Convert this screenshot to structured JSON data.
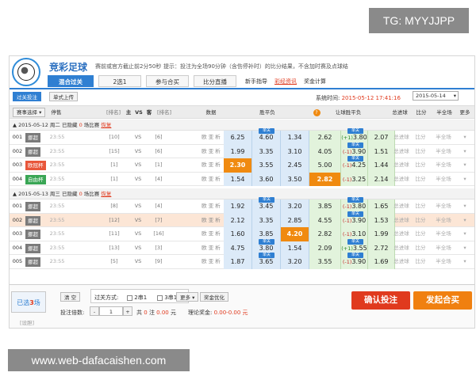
{
  "overlay": {
    "tg": "TG: MYYJJPP",
    "watermark": "www.web-dafacaishen.com"
  },
  "header": {
    "title": "竞彩足球",
    "tip_deadline": "赛前或官方截止前2分50秒",
    "tip_note": "提示：投注为全场90分钟（含伤停补时）的比分结果，不含加时赛及点球结",
    "tabs": [
      "混合过关",
      "2选1",
      "参与合买",
      "比分直播"
    ],
    "links": [
      "新手指导",
      "彩经资讯",
      "奖金计算"
    ]
  },
  "toolbar": {
    "btn_parlay": "过关投注",
    "btn_single": "单式上传",
    "systime_label": "系统时间:",
    "systime_value": "2015-05-12 17:41:16",
    "date_value": "2015-05-14"
  },
  "columns": {
    "filter": "赛事选择",
    "stop": "停售",
    "rank_home": "[排名]",
    "home": "主",
    "vs": "VS",
    "away": "客",
    "rank_away": "[排名]",
    "data": "数据",
    "spf": "胜平负",
    "rq": "让球胜平负",
    "goals": "总进球",
    "score": "比分",
    "half": "半全场",
    "more": "更多"
  },
  "groups": [
    {
      "date": "2015-05-12 周二",
      "hidden_label": "已隐藏",
      "hidden_count": "0",
      "hidden_suffix": "场比赛",
      "show_link": "恢复",
      "rows": [
        {
          "no": "001",
          "league": "挪超",
          "lcolor": "#7a7a7a",
          "time": "23:55",
          "rh": "[10]",
          "vs": "VS",
          "ra": "[6]",
          "data": "欧 亚 析",
          "spf": [
            "6.25",
            "4.60",
            "1.34"
          ],
          "spf_pick": -1,
          "dan": true,
          "rq_line": "(+1)",
          "rq_neg": false,
          "rq": [
            "2.62",
            "3.80",
            "2.07"
          ],
          "rq_pick": -1,
          "rq_dan": true,
          "goals": "总进球",
          "score": "比分",
          "half": "半全场",
          "hl": false
        },
        {
          "no": "002",
          "league": "挪超",
          "lcolor": "#7a7a7a",
          "time": "23:55",
          "rh": "[15]",
          "vs": "VS",
          "ra": "[6]",
          "data": "欧 亚 析",
          "spf": [
            "1.99",
            "3.35",
            "3.10"
          ],
          "spf_pick": -1,
          "dan": false,
          "rq_line": "(-1)",
          "rq_neg": true,
          "rq": [
            "4.05",
            "3.90",
            "1.51"
          ],
          "rq_pick": -1,
          "rq_dan": true,
          "goals": "总进球",
          "score": "比分",
          "half": "半全场",
          "hl": false
        },
        {
          "no": "003",
          "league": "欧冠杯",
          "lcolor": "#e8563a",
          "time": "23:55",
          "rh": "[1]",
          "vs": "VS",
          "ra": "[1]",
          "data": "欧 亚 析",
          "spf": [
            "2.30",
            "3.55",
            "2.45"
          ],
          "spf_pick": 0,
          "dan": false,
          "rq_line": "(-1)",
          "rq_neg": true,
          "rq": [
            "5.00",
            "4.25",
            "1.44"
          ],
          "rq_pick": -1,
          "rq_dan": true,
          "goals": "总进球",
          "score": "比分",
          "half": "半全场",
          "hl": false
        },
        {
          "no": "004",
          "league": "自由杯",
          "lcolor": "#3aa655",
          "time": "23:55",
          "rh": "[1]",
          "vs": "VS",
          "ra": "[4]",
          "data": "欧 亚 析",
          "spf": [
            "1.54",
            "3.60",
            "3.50"
          ],
          "spf_pick": -1,
          "dan": false,
          "rq_line": "(-1)",
          "rq_neg": true,
          "rq": [
            "2.82",
            "3.25",
            "2.14"
          ],
          "rq_pick": 0,
          "rq_dan": false,
          "goals": "总进球",
          "score": "比分",
          "half": "半全场",
          "hl": false
        }
      ]
    },
    {
      "date": "2015-05-13 周三",
      "hidden_label": "已隐藏",
      "hidden_count": "0",
      "hidden_suffix": "场比赛",
      "show_link": "恢复",
      "rows": [
        {
          "no": "001",
          "league": "挪超",
          "lcolor": "#7a7a7a",
          "time": "23:55",
          "rh": "[8]",
          "vs": "VS",
          "ra": "[4]",
          "data": "欧 亚 析",
          "spf": [
            "1.92",
            "3.45",
            "3.20"
          ],
          "spf_pick": -1,
          "dan": true,
          "rq_line": "(-1)",
          "rq_neg": true,
          "rq": [
            "3.85",
            "3.80",
            "1.65"
          ],
          "rq_pick": -1,
          "rq_dan": true,
          "goals": "总进球",
          "score": "比分",
          "half": "半全场",
          "hl": false
        },
        {
          "no": "002",
          "league": "挪超",
          "lcolor": "#7a7a7a",
          "time": "23:55",
          "rh": "[12]",
          "vs": "VS",
          "ra": "[7]",
          "data": "欧 亚 析",
          "spf": [
            "2.12",
            "3.35",
            "2.85"
          ],
          "spf_pick": -1,
          "dan": false,
          "rq_line": "(-1)",
          "rq_neg": true,
          "rq": [
            "4.55",
            "3.90",
            "1.53"
          ],
          "rq_pick": -1,
          "rq_dan": true,
          "goals": "总进球",
          "score": "比分",
          "half": "半全场",
          "hl": true
        },
        {
          "no": "003",
          "league": "挪超",
          "lcolor": "#7a7a7a",
          "time": "23:55",
          "rh": "[11]",
          "vs": "VS",
          "ra": "[16]",
          "data": "欧 亚 析",
          "spf": [
            "1.60",
            "3.85",
            "4.20"
          ],
          "spf_pick": 2,
          "dan": false,
          "rq_line": "(-1)",
          "rq_neg": true,
          "rq": [
            "2.82",
            "3.10",
            "1.99"
          ],
          "rq_pick": -1,
          "rq_dan": false,
          "goals": "总进球",
          "score": "比分",
          "half": "半全场",
          "hl": false
        },
        {
          "no": "004",
          "league": "挪超",
          "lcolor": "#7a7a7a",
          "time": "23:55",
          "rh": "[13]",
          "vs": "VS",
          "ra": "[3]",
          "data": "欧 亚 析",
          "spf": [
            "4.75",
            "3.80",
            "1.54"
          ],
          "spf_pick": -1,
          "dan": true,
          "rq_line": "(+1)",
          "rq_neg": false,
          "rq": [
            "2.09",
            "3.55",
            "2.72"
          ],
          "rq_pick": -1,
          "rq_dan": true,
          "goals": "总进球",
          "score": "比分",
          "half": "半全场",
          "hl": false
        },
        {
          "no": "005",
          "league": "挪超",
          "lcolor": "#7a7a7a",
          "time": "23:55",
          "rh": "[5]",
          "vs": "VS",
          "ra": "[9]",
          "data": "欧 亚 析",
          "spf": [
            "1.87",
            "3.65",
            "3.20"
          ],
          "spf_pick": -1,
          "dan": true,
          "rq_line": "(-1)",
          "rq_neg": true,
          "rq": [
            "3.55",
            "3.90",
            "1.69"
          ],
          "rq_pick": -1,
          "rq_dan": true,
          "goals": "总进球",
          "score": "比分",
          "half": "半全场",
          "hl": false
        }
      ]
    }
  ],
  "footer": {
    "selected_prefix": "已选",
    "selected_count": "3",
    "selected_suffix": "场",
    "settings": "[设胆]",
    "clear": "清 空",
    "parlay_label": "过关方式:",
    "opt1": "2串1",
    "opt2": "3串1",
    "more": "更多",
    "optimize": "奖金优化",
    "mult_label": "投注倍数:",
    "mult_value": "1",
    "total_prefix": "共",
    "total_count": "0",
    "total_mid": "注",
    "total_amount": "0.00",
    "total_unit": "元",
    "theory_label": "理论奖金:",
    "theory_value": "0.00-0.00",
    "theory_unit": "元",
    "confirm": "确认投注",
    "launch": "发起合买"
  },
  "colors": {
    "accent": "#2f7fd2",
    "red": "#e03a1e",
    "orange": "#f08a10",
    "spf_bg": "#dceaf8",
    "rq_bg": "#e2f3dc"
  }
}
